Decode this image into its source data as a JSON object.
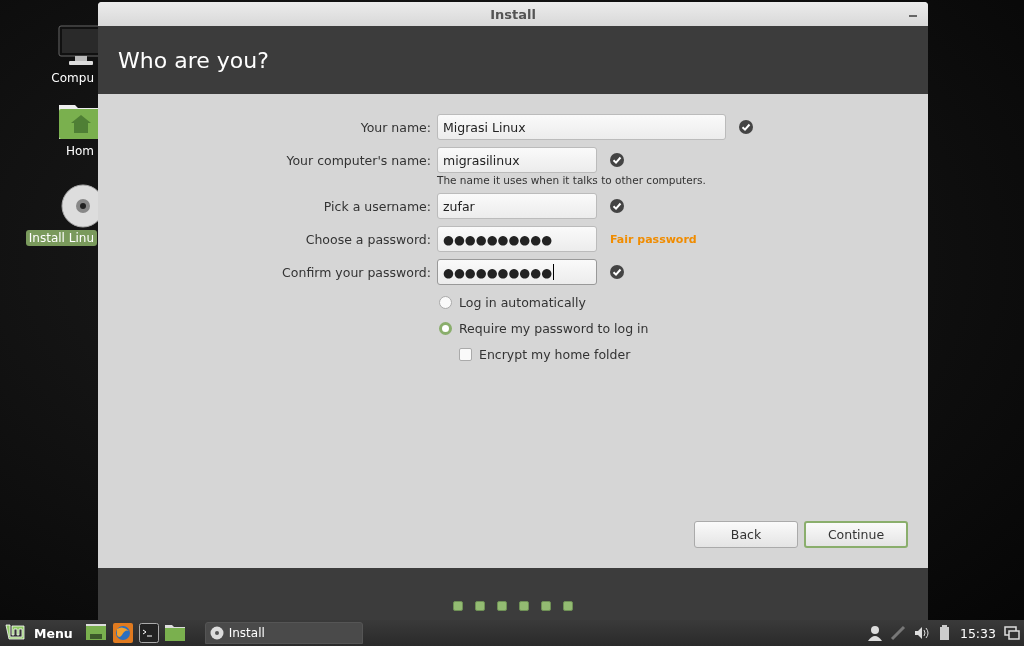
{
  "desktop_icons": [
    {
      "kind": "computer",
      "label": "Compu",
      "selected": false
    },
    {
      "kind": "home",
      "label": "Hom",
      "selected": false
    },
    {
      "kind": "disc",
      "label": "Install Linu",
      "selected": true
    }
  ],
  "window": {
    "title": "Install",
    "heading": "Who are you?"
  },
  "form": {
    "fields": [
      {
        "label": "Your name:",
        "value": "Migrasi Linux",
        "verified": true,
        "focused": false
      },
      {
        "label": "Your computer's name:",
        "value": "migrasilinux",
        "verified": true,
        "focused": false,
        "hint": "The name it uses when it talks to other computers."
      },
      {
        "label": "Pick a username:",
        "value": "zufar",
        "verified": true,
        "focused": false
      },
      {
        "label": "Choose a password:",
        "value": "●●●●●●●●●●",
        "verified": false,
        "focused": false,
        "strength": "Fair password"
      },
      {
        "label": "Confirm your password:",
        "value": "●●●●●●●●●●",
        "verified": true,
        "focused": true
      }
    ],
    "login_options": [
      {
        "label": "Log in automatically",
        "selected": false
      },
      {
        "label": "Require my password to log in",
        "selected": true
      }
    ],
    "encrypt": {
      "label": "Encrypt my home folder",
      "checked": false
    }
  },
  "buttons": [
    {
      "label": "Back",
      "default": false
    },
    {
      "label": "Continue",
      "default": true
    }
  ],
  "taskbar": {
    "menu_label": "Menu",
    "window_button": "Install",
    "clock": "15:33"
  }
}
